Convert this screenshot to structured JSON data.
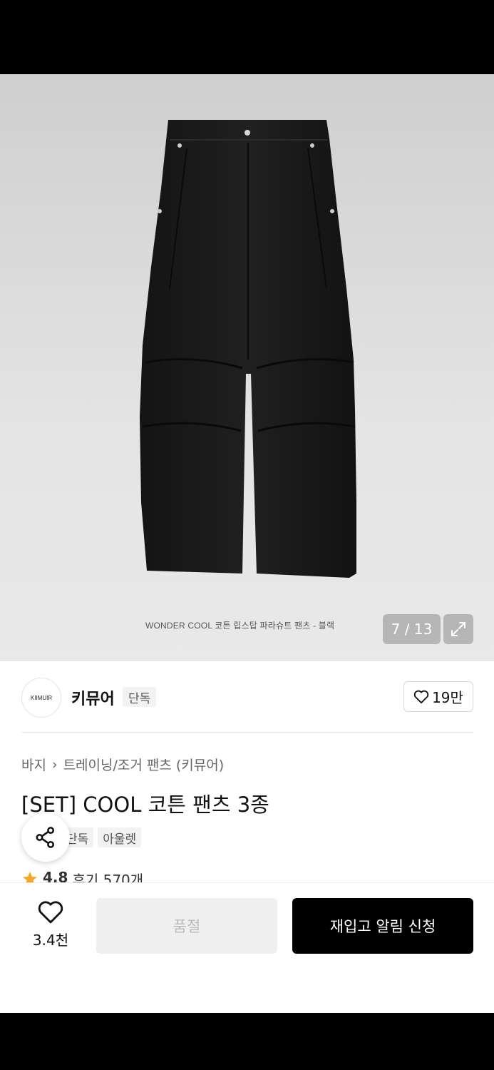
{
  "gallery": {
    "caption": "WONDER COOL 코튼 립스탑 파라슈트 팬츠 - 블랙",
    "counter": "7 / 13"
  },
  "brand": {
    "logo_text": "KIIMUIR",
    "name": "키뮤어",
    "tag": "단독",
    "follow_count": "19만"
  },
  "product": {
    "breadcrumb": [
      "바지",
      "트레이닝/조거 팬츠 (키뮤어)"
    ],
    "title": "[SET] COOL 코튼 팬츠 3종",
    "tags": [
      "단독",
      "아울렛"
    ],
    "rating": {
      "score": "4.8",
      "review_text": "후기 570개"
    }
  },
  "actions": {
    "like_count": "3.4천",
    "soldout_label": "품절",
    "restock_label": "재입고 알림 신청"
  },
  "colors": {
    "accent_star": "#f5a623",
    "primary_button": "#000000"
  }
}
